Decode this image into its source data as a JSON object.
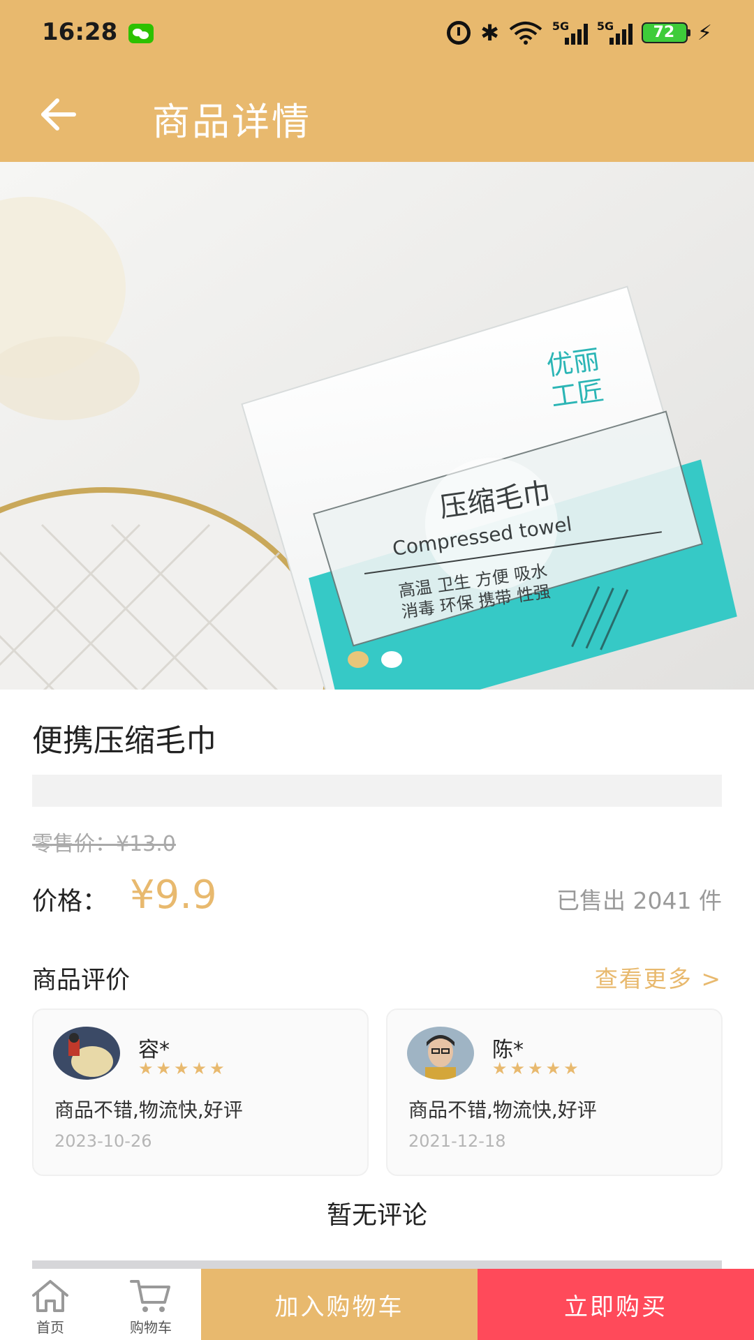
{
  "status_bar": {
    "time": "16:28",
    "signal_1": "5G",
    "signal_2": "5G",
    "battery": "72"
  },
  "header": {
    "title": "商品详情"
  },
  "product": {
    "image_label": "product-photo-compressed-towel",
    "carousel_count": 2,
    "carousel_active": 0,
    "name": "便携压缩毛巾",
    "retail_price": "零售价：¥13.0",
    "price_label": "价格：",
    "price": "¥9.9",
    "sold": "已售出 2041 件"
  },
  "reviews": {
    "title": "商品评价",
    "see_more": "查看更多 >",
    "items": [
      {
        "name": "容*",
        "stars": "★★★★★",
        "rating": 5,
        "text": "商品不错,物流快,好评",
        "date": "2023-10-26"
      },
      {
        "name": "陈*",
        "stars": "★★★★★",
        "rating": 5,
        "text": "商品不错,物流快,好评",
        "date": "2021-12-18"
      }
    ],
    "empty_text": "暂无评论"
  },
  "bottom_nav": {
    "home": "首页",
    "cart": "购物车",
    "add_to_cart": "加入购物车",
    "buy_now": "立即购买"
  },
  "colors": {
    "primary": "#E8B96E",
    "buy": "#FF4A5A"
  }
}
